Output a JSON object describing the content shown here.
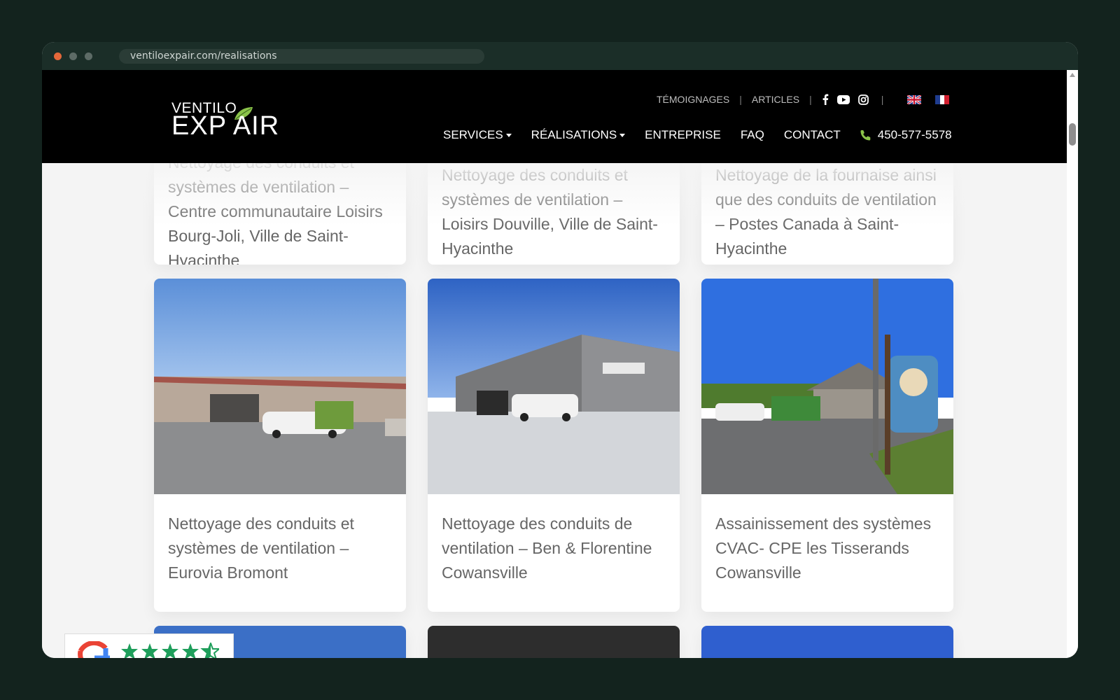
{
  "browser": {
    "url": "ventiloexpair.com/realisations"
  },
  "logo": {
    "top": "VENTILO",
    "main_left": "EXP",
    "main_right": "AIR"
  },
  "top_nav": {
    "items": [
      "TÉMOIGNAGES",
      "ARTICLES"
    ]
  },
  "main_nav": {
    "items": [
      "SERVICES",
      "RÉALISATIONS",
      "ENTREPRISE",
      "FAQ",
      "CONTACT"
    ],
    "phone": "450-577-5578"
  },
  "projects": [
    {
      "title": "Nettoyage des conduits et systèmes de ventilation – Centre communautaire Loisirs Bourg-Joli, Ville de Saint-Hyacinthe"
    },
    {
      "title": "Nettoyage des conduits et systèmes de ventilation – Loisirs Douville, Ville de Saint-Hyacinthe"
    },
    {
      "title": "Nettoyage de la fournaise ainsi que des conduits de ventilation – Postes Canada à Saint-Hyacinthe"
    },
    {
      "title": "Nettoyage des conduits et systèmes de ventilation – Eurovia Bromont"
    },
    {
      "title": "Nettoyage des conduits de ventilation – Ben & Florentine Cowansville"
    },
    {
      "title": "Assainissement des systèmes CVAC- CPE les Tisserands Cowansville"
    }
  ],
  "review_widget": {
    "stars": 4.5
  },
  "icons": [
    "facebook-icon",
    "youtube-icon",
    "instagram-icon",
    "uk-flag-icon",
    "fr-flag-icon",
    "phone-icon",
    "google-icon",
    "star-icon"
  ],
  "colors": {
    "header": "#000000",
    "accent_green": "#8bc34a",
    "card_text": "#666666"
  }
}
